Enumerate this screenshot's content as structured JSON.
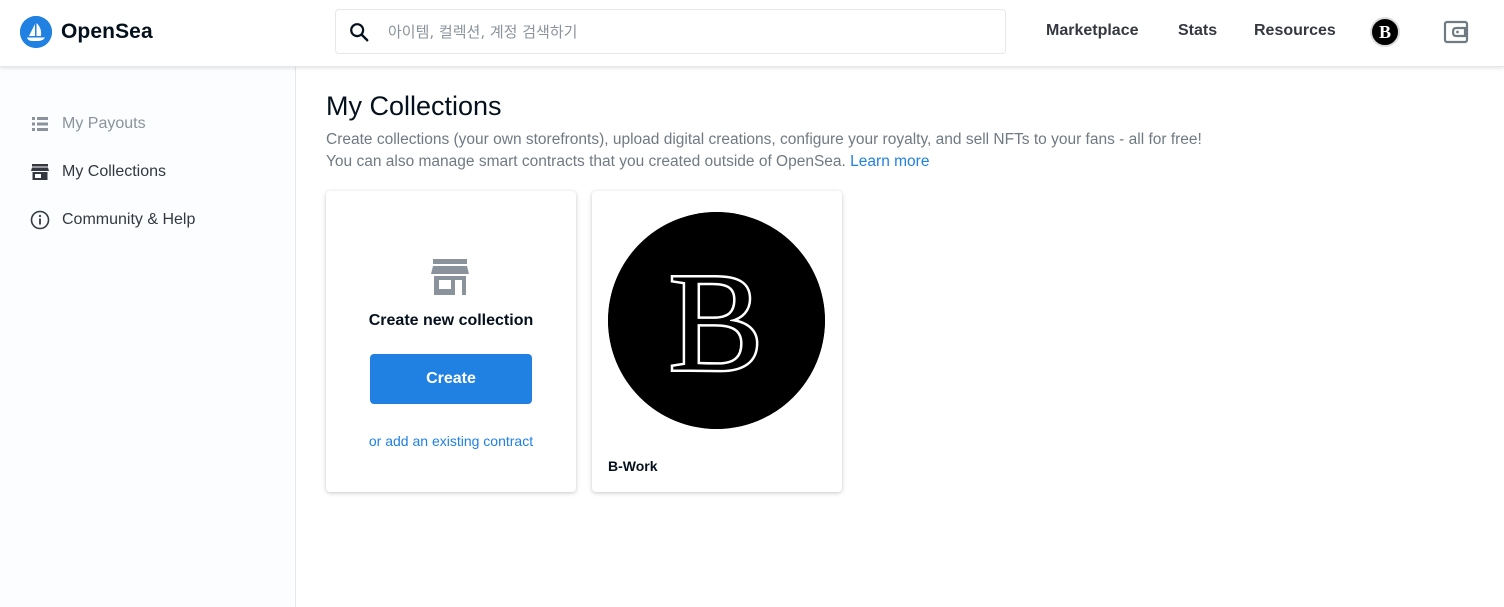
{
  "header": {
    "brand": "OpenSea",
    "search_placeholder": "아이템, 컬렉션, 계정 검색하기",
    "nav": [
      "Marketplace",
      "Stats",
      "Resources"
    ],
    "avatar_letter": "B"
  },
  "sidebar": {
    "items": [
      {
        "label": "My Payouts",
        "icon": "list-icon",
        "color": "#8a939b"
      },
      {
        "label": "My Collections",
        "icon": "storefront-icon",
        "color": "#353840"
      },
      {
        "label": "Community & Help",
        "icon": "info-icon",
        "color": "#353840"
      }
    ]
  },
  "main": {
    "title": "My Collections",
    "desc_line1": "Create collections (your own storefronts), upload digital creations, configure your royalty, and sell NFTs to your fans - all for free!",
    "desc_line2": "You can also manage smart contracts that you created outside of OpenSea.",
    "learn_more": "Learn more",
    "new_card": {
      "title": "Create new collection",
      "button": "Create",
      "link": "or add an existing contract"
    },
    "collections": [
      {
        "name": "B-Work",
        "image_letter": "B"
      }
    ]
  },
  "colors": {
    "accent": "#2081e2",
    "muted": "#8a939b"
  }
}
